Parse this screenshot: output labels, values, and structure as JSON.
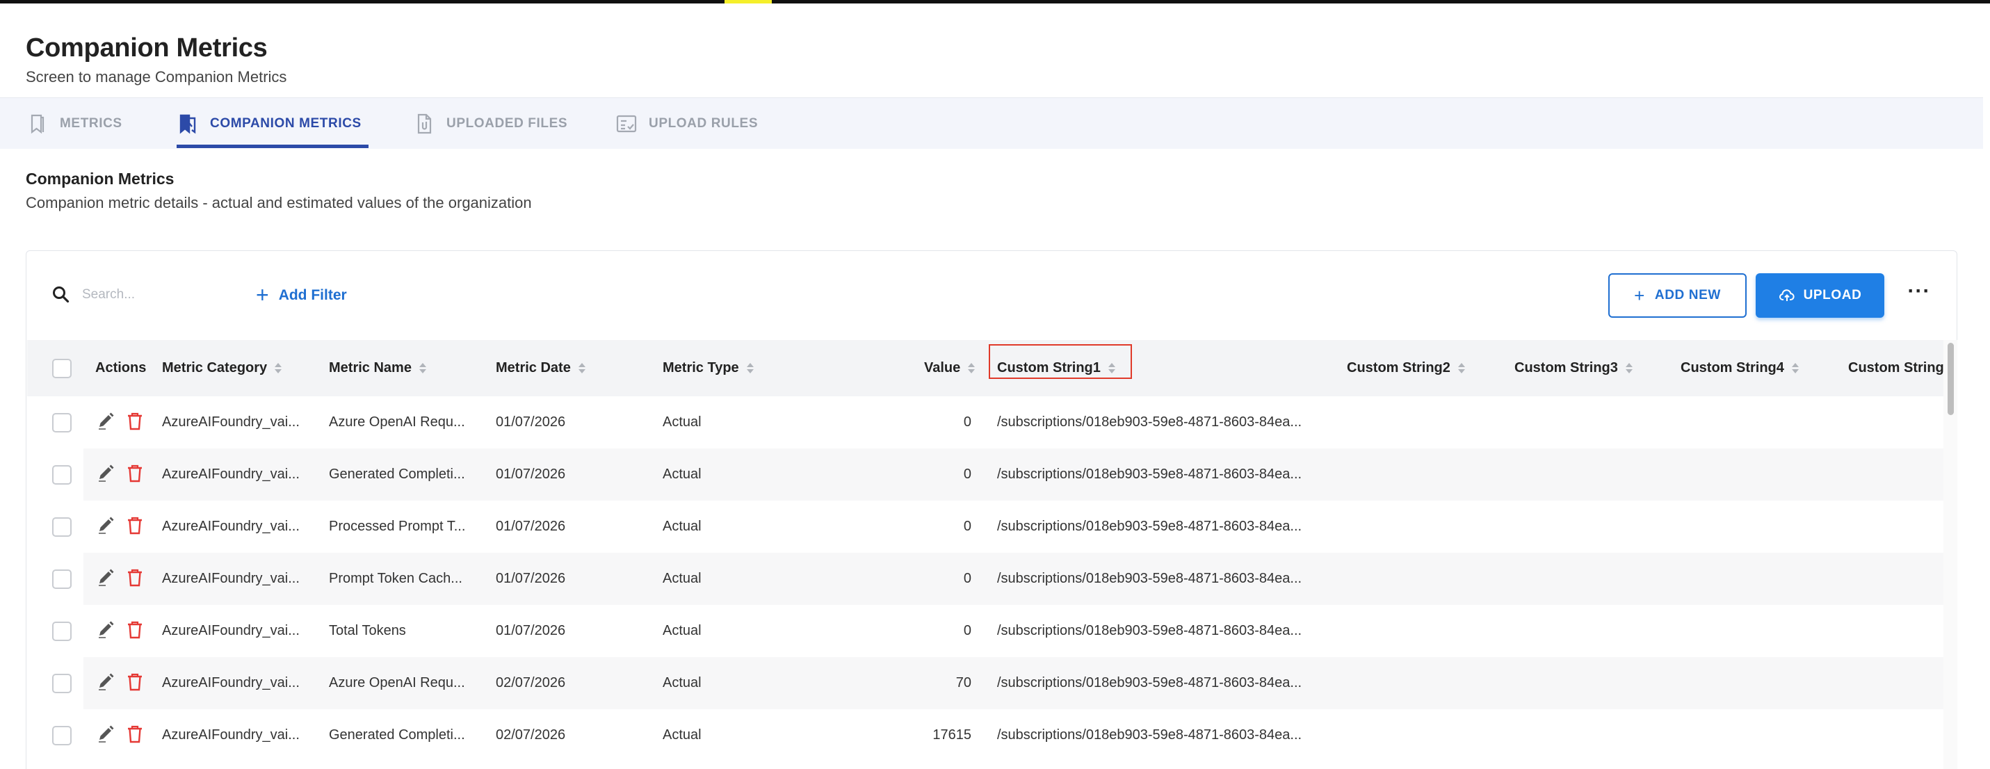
{
  "header": {
    "title": "Companion Metrics",
    "subtitle": "Screen to manage Companion Metrics"
  },
  "tabs": [
    {
      "label": "METRICS",
      "icon": "bookmark-icon",
      "active": false
    },
    {
      "label": "COMPANION METRICS",
      "icon": "companion-bookmark-icon",
      "active": true
    },
    {
      "label": "UPLOADED FILES",
      "icon": "file-attachment-icon",
      "active": false
    },
    {
      "label": "UPLOAD RULES",
      "icon": "checklist-icon",
      "active": false
    }
  ],
  "section": {
    "title": "Companion Metrics",
    "description": "Companion metric details - actual and estimated values of the organization"
  },
  "toolbar": {
    "search_placeholder": "Search...",
    "add_filter_label": "Add Filter",
    "add_new_label": "ADD NEW",
    "upload_label": "UPLOAD",
    "more_label": "···"
  },
  "table": {
    "columns": [
      "Actions",
      "Metric Category",
      "Metric Name",
      "Metric Date",
      "Metric Type",
      "Value",
      "Custom String1",
      "Custom String2",
      "Custom String3",
      "Custom String4",
      "Custom String"
    ],
    "rows": [
      {
        "category": "AzureAIFoundry_vai...",
        "name": "Azure OpenAI Requ...",
        "date": "01/07/2026",
        "type": "Actual",
        "value": "0",
        "custom1": "/subscriptions/018eb903-59e8-4871-8603-84ea..."
      },
      {
        "category": "AzureAIFoundry_vai...",
        "name": "Generated Completi...",
        "date": "01/07/2026",
        "type": "Actual",
        "value": "0",
        "custom1": "/subscriptions/018eb903-59e8-4871-8603-84ea..."
      },
      {
        "category": "AzureAIFoundry_vai...",
        "name": "Processed Prompt T...",
        "date": "01/07/2026",
        "type": "Actual",
        "value": "0",
        "custom1": "/subscriptions/018eb903-59e8-4871-8603-84ea..."
      },
      {
        "category": "AzureAIFoundry_vai...",
        "name": "Prompt Token Cach...",
        "date": "01/07/2026",
        "type": "Actual",
        "value": "0",
        "custom1": "/subscriptions/018eb903-59e8-4871-8603-84ea..."
      },
      {
        "category": "AzureAIFoundry_vai...",
        "name": "Total Tokens",
        "date": "01/07/2026",
        "type": "Actual",
        "value": "0",
        "custom1": "/subscriptions/018eb903-59e8-4871-8603-84ea..."
      },
      {
        "category": "AzureAIFoundry_vai...",
        "name": "Azure OpenAI Requ...",
        "date": "02/07/2026",
        "type": "Actual",
        "value": "70",
        "custom1": "/subscriptions/018eb903-59e8-4871-8603-84ea..."
      },
      {
        "category": "AzureAIFoundry_vai...",
        "name": "Generated Completi...",
        "date": "02/07/2026",
        "type": "Actual",
        "value": "17615",
        "custom1": "/subscriptions/018eb903-59e8-4871-8603-84ea..."
      }
    ]
  },
  "colors": {
    "accent": "#1f6fd1",
    "active_tab": "#2c4aa8",
    "delete": "#e53935",
    "highlight": "#e03a2a"
  }
}
